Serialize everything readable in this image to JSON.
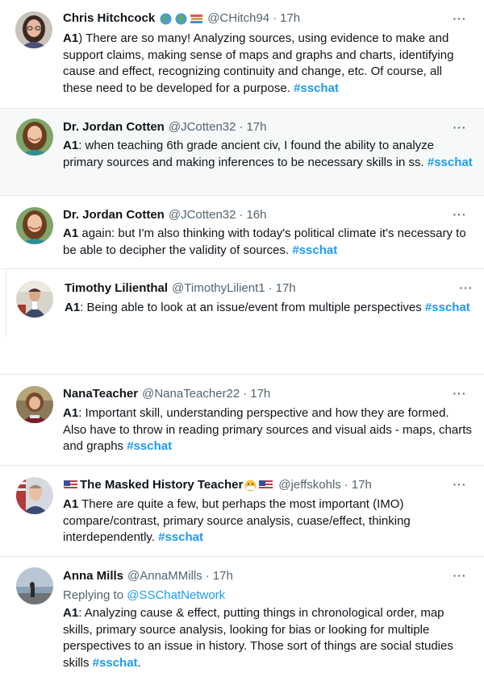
{
  "more_label": "···",
  "tweets": [
    {
      "name": "Chris Hitchcock",
      "name_emojis": [
        "globe-americas",
        "globe-africa",
        "books"
      ],
      "handle": "@CHitch94",
      "time": "17h",
      "prefix": "A1",
      "text": ") There are so many! Analyzing sources, using evidence to make and support claims, making sense of maps and graphs and charts, identifying cause and effect, recognizing continuity and change, etc. Of course, all these need to be developed for a purpose. ",
      "hashtag": "#sschat"
    },
    {
      "name": "Dr. Jordan Cotten",
      "handle": "@JCotten32",
      "time": "17h",
      "prefix": "A1",
      "text": ": when teaching 6th grade ancient civ, I found the ability to analyze primary sources and making inferences to be necessary skills in ss. ",
      "hashtag": "#sschat"
    },
    {
      "name": "Dr. Jordan Cotten",
      "handle": "@JCotten32",
      "time": "16h",
      "prefix": "A1",
      "text": " again: but I'm also thinking with today's political climate it's necessary to be able to decipher the validity of sources. ",
      "hashtag": "#sschat"
    },
    {
      "name": "Timothy Lilienthal",
      "handle": "@TimothyLilient1",
      "time": "17h",
      "prefix": "A1",
      "text": ": Being able to look at an issue/event from multiple perspectives ",
      "hashtag": "#sschat"
    },
    {
      "name": "NanaTeacher",
      "handle": "@NanaTeacher22",
      "time": "17h",
      "prefix": "A1",
      "text": ": Important skill, understanding perspective and how they are formed. Also have to throw in reading primary sources and visual aids - maps, charts and graphs ",
      "hashtag": "#sschat"
    },
    {
      "name": "The Masked History Teacher",
      "name_emojis": [
        "us-flag",
        "mask",
        "us-flag"
      ],
      "handle": "@jeffskohls",
      "time": "17h",
      "prefix": "A1",
      "text": " There are quite a few, but perhaps the most important (IMO) compare/contrast, primary source analysis, cuase/effect, thinking interdependently. ",
      "hashtag": "#sschat"
    },
    {
      "name": "Anna Mills",
      "handle": "@AnnaMMills",
      "time": "17h",
      "replying_label": "Replying to ",
      "replying_to": "@SSChatNetwork",
      "prefix": "A1",
      "text": ":  Analyzing cause & effect, putting things in chronological order, map skills, primary source analysis, looking for bias or looking for multiple perspectives to an issue in history.  Those sort of things are social studies skills ",
      "hashtag": "#sschat",
      "suffix": "."
    }
  ]
}
